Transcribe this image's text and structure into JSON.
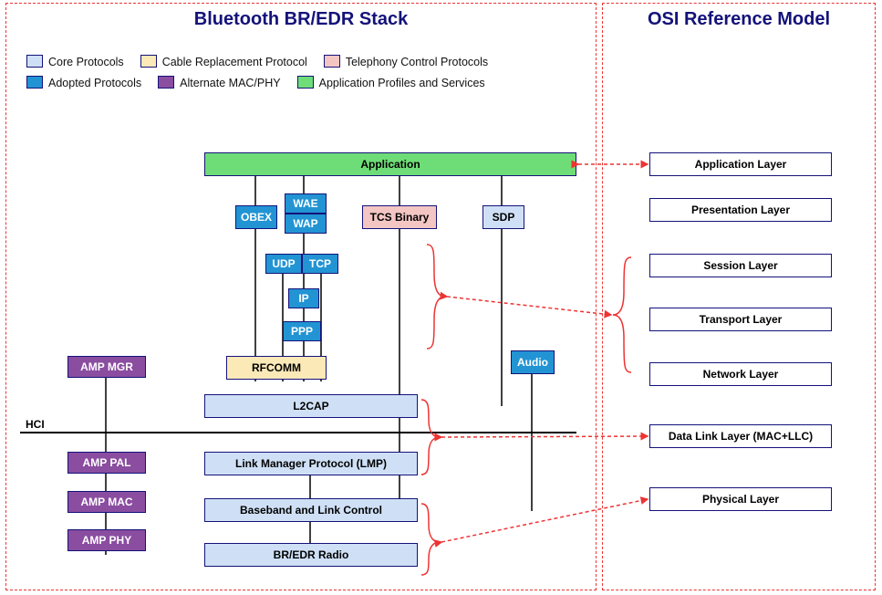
{
  "left_panel_title": "Bluetooth BR/EDR Stack",
  "right_panel_title": "OSI Reference Model",
  "legend": {
    "core_protocols": "Core Protocols",
    "cable_replacement": "Cable Replacement Protocol",
    "telephony_control": "Telephony Control Protocols",
    "adopted_protocols": "Adopted Protocols",
    "alternate_mac_phy": "Alternate MAC/PHY",
    "app_profiles": "Application Profiles and Services"
  },
  "colors": {
    "core": "#cfe0f6",
    "cable": "#fbe9b8",
    "telephony": "#f3c6c4",
    "adopted": "#2294d4",
    "amp": "#8a4da0",
    "app": "#6fdd77",
    "osi_fill": "#ffffff",
    "border": "#14127a",
    "red": "#e33"
  },
  "stack": {
    "application": "Application",
    "obex": "OBEX",
    "wae": "WAE",
    "wap": "WAP",
    "tcs": "TCS Binary",
    "sdp": "SDP",
    "udp": "UDP",
    "tcp": "TCP",
    "ip": "IP",
    "ppp": "PPP",
    "rfcomm": "RFCOMM",
    "audio": "Audio",
    "l2cap": "L2CAP",
    "lmp": "Link Manager Protocol (LMP)",
    "baseband": "Baseband and Link Control",
    "radio": "BR/EDR Radio",
    "amp_mgr": "AMP MGR",
    "amp_pal": "AMP PAL",
    "amp_mac": "AMP MAC",
    "amp_phy": "AMP PHY",
    "hci": "HCI"
  },
  "osi": {
    "l7": "Application Layer",
    "l6": "Presentation Layer",
    "l5": "Session Layer",
    "l4": "Transport Layer",
    "l3": "Network Layer",
    "l2": "Data Link Layer (MAC+LLC)",
    "l1": "Physical Layer"
  }
}
